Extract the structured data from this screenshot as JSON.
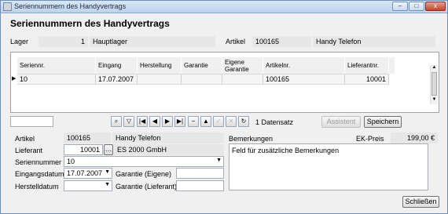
{
  "window": {
    "title": "Seriennummern des Handyvertrags",
    "min": "–",
    "max": "□",
    "close": "x"
  },
  "header": {
    "title": "Seriennummern des Handyvertrags"
  },
  "top": {
    "lager_label": "Lager",
    "lager_nr": "1",
    "lager_name": "Hauptlager",
    "artikel_label": "Artikel",
    "artikel_nr": "100165",
    "artikel_name": "Handy Telefon"
  },
  "grid": {
    "columns": [
      "Seriennr.",
      "Eingang",
      "Herstellung",
      "Garantie",
      "Eigene Garantie",
      "Artikelnr.",
      "Lieferantnr."
    ],
    "rows": [
      {
        "seriennr": "10",
        "eingang": "17.07.2007",
        "herstellung": "",
        "garantie": "",
        "eigene_garantie": "",
        "artikelnr": "100165",
        "lieferantnr": "10001"
      }
    ]
  },
  "toolbar": {
    "record_count": "1 Datensatz",
    "assistent": "Assistent",
    "speichern": "Speichern",
    "icons": [
      "binoculars-icon",
      "filter-icon",
      "first-icon",
      "prev-icon",
      "next-icon",
      "last-icon",
      "minus-icon",
      "up-icon",
      "check-icon",
      "cancel-icon",
      "refresh-icon"
    ]
  },
  "form": {
    "artikel_label": "Artikel",
    "artikel_nr": "100165",
    "artikel_name": "Handy Telefon",
    "lieferant_label": "Lieferant",
    "lieferant_nr": "10001",
    "lieferant_dots": "…",
    "lieferant_name": "ES 2000 GmbH",
    "seriennummer_label": "Seriennummer",
    "seriennummer_value": "10",
    "eingangsdatum_label": "Eingangsdatum",
    "eingangsdatum_value": "17.07.2007",
    "garantie_eigene_label": "Garantie (Eigene)",
    "garantie_eigene_value": "",
    "herstelldatum_label": "Herstelldatum",
    "herstelldatum_value": "",
    "garantie_lieferant_label": "Garantie (Lieferant)",
    "garantie_lieferant_value": "",
    "bemerkungen_label": "Bemerkungen",
    "ekpreis_label": "EK-Preis",
    "ekpreis_value": "199,00 €",
    "bemerkungen_value": "Feld für zusätzliche Bemerkungen"
  },
  "footer": {
    "close_label": "Schließen"
  }
}
